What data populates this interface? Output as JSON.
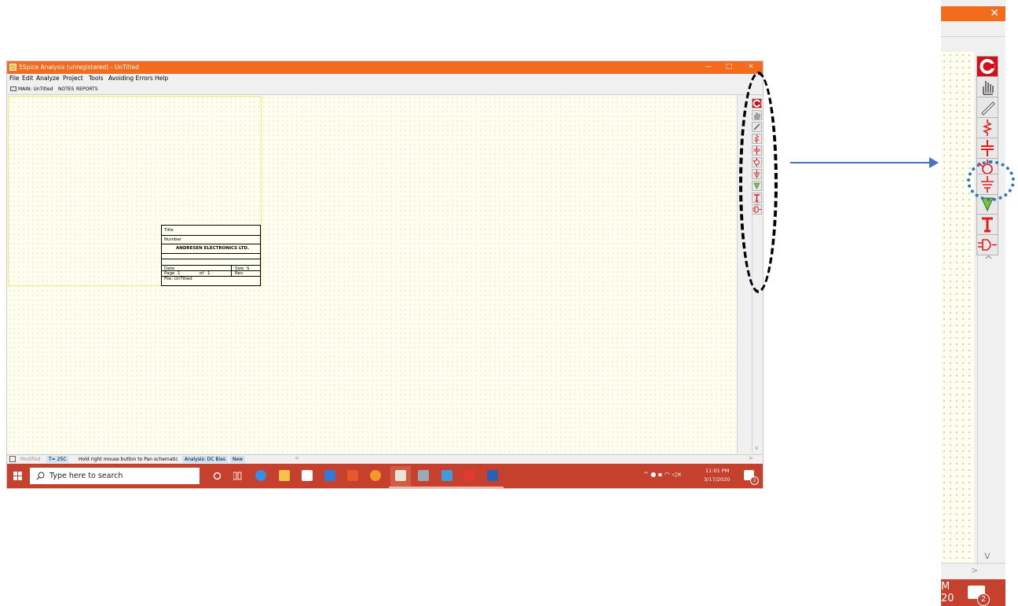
{
  "window": {
    "title": "5Spice Analysis (unregistered) - UnTitled",
    "controls": {
      "minimize": "—",
      "maximize": "□",
      "close": "✕"
    }
  },
  "menu": [
    "File",
    "Edit",
    "Analyze",
    "Project",
    "Tools",
    "Avoiding Errors",
    "Help"
  ],
  "tabs": [
    "MAIN: UnTitled",
    "NOTES",
    "REPORTS"
  ],
  "title_block": {
    "title_label": "Title",
    "number_label": "Number",
    "company": "ANDRESEN ELECTRONICS LTD.",
    "date_label": "Date",
    "size_label": "Size",
    "size_value": "S",
    "page_label": "Page",
    "page_num": "1",
    "of_label": "of",
    "page_total": "1",
    "rev_label": "Rev",
    "file_label": "File: UnTitled"
  },
  "toolbar_icons": [
    "5spice-logo-icon",
    "hand-icon",
    "pencil-icon",
    "resistor-icon",
    "capacitor-icon",
    "voltage-source-icon",
    "ground-icon",
    "probe-icon",
    "text-icon",
    "gate-icon"
  ],
  "status": {
    "modified": "Modified",
    "temp": "T= 25C",
    "hint": "Hold right mouse button to Pan schematic",
    "analysis": "Analysis: DC Bias",
    "mode": "New"
  },
  "taskbar": {
    "search_placeholder": "Type here to search",
    "time": "11:01 PM",
    "date": "3/17/2020",
    "notification_count": "2"
  },
  "zoom_panel": {
    "close": "✕",
    "clock_fragment_1": "M",
    "clock_fragment_2": "20",
    "notification_count": "2"
  },
  "colors": {
    "titlebar": "#f36b1c",
    "taskbar": "#c5402d",
    "canvas": "#fffff0",
    "component_red": "#e41b1b",
    "highlight_blue": "#2e75b6",
    "arrow": "#4472c4"
  }
}
